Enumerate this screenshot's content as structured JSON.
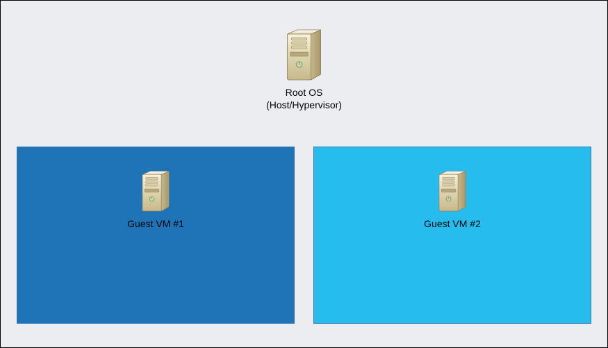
{
  "root": {
    "label_line1": "Root OS",
    "label_line2": "(Host/Hypervisor)"
  },
  "vms": {
    "vm1": {
      "label": "Guest VM #1",
      "bg_color": "#1F74B7"
    },
    "vm2": {
      "label": "Guest VM #2",
      "bg_color": "#27BCEE"
    }
  },
  "colors": {
    "canvas_bg": "#EBEDF0",
    "panel_border": "#2E75B6"
  }
}
